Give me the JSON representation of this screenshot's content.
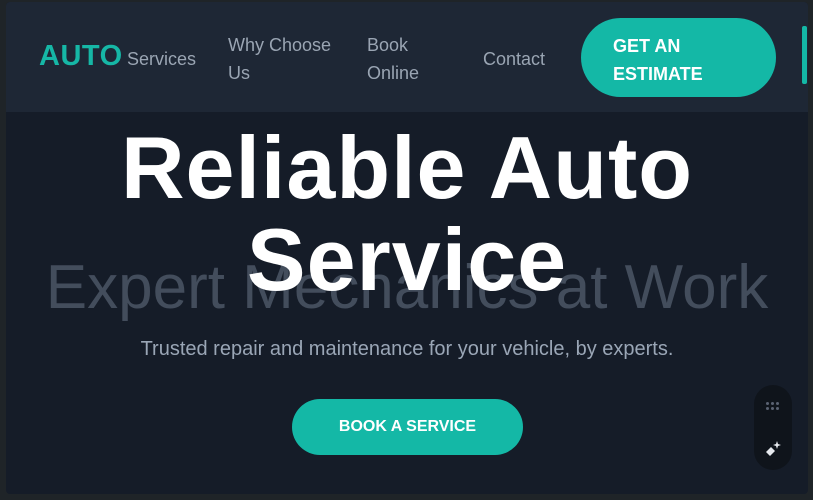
{
  "navbar": {
    "logo": "AUTO",
    "links": [
      "Services",
      "Why Choose Us",
      "Book Online",
      "Contact"
    ],
    "cta_label": "GET AN ESTIMATE"
  },
  "hero": {
    "background_text": "Expert Mechanics at Work",
    "title_line1": "Reliable Auto",
    "title_line2": "Service",
    "subtitle": "Trusted repair and maintenance for your vehicle, by experts.",
    "button_label": "BOOK A SERVICE"
  },
  "widget": {
    "icons": [
      "grid-dots-icon",
      "sparkle-icon"
    ]
  },
  "colors": {
    "accent": "#14b8a6",
    "page_bg": "#151c28",
    "nav_bg": "#1e2735"
  }
}
